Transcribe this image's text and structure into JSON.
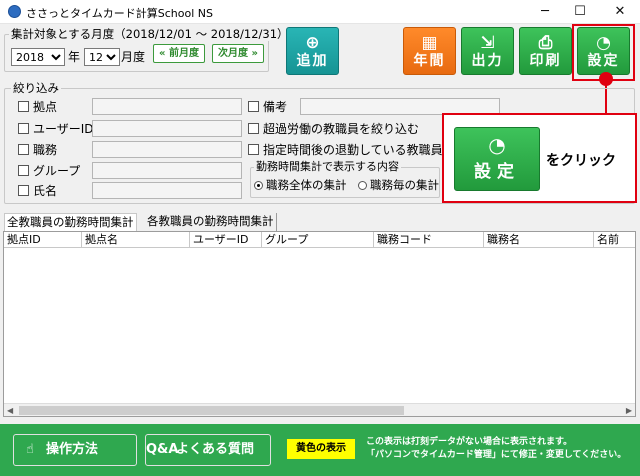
{
  "window": {
    "title": "ささっとタイムカード計算School NS",
    "minimize_label": "─",
    "maximize_label": "☐",
    "close_label": "✕"
  },
  "period": {
    "group_label": "集計対象とする月度（2018/12/01 〜 2018/12/31）",
    "year_value": "2018",
    "year_unit": "年",
    "month_value": "12",
    "month_unit": "月度",
    "prev_label": "« 前月度",
    "next_label": "次月度 »"
  },
  "toolbar": {
    "add_label": "追加",
    "annual_label": "年間",
    "output_label": "出力",
    "print_label": "印刷",
    "settings_label": "設定"
  },
  "filter": {
    "group_label": "絞り込み",
    "base_label": "拠点",
    "userid_label": "ユーザーID",
    "job_label": "職務",
    "group_field_label": "グループ",
    "name_label": "氏名",
    "remarks_label": "備考",
    "overtime_label": "超過労働の教職員を絞り込む",
    "early_leave_label": "指定時間後の退勤している教職員を",
    "display_group_label": "勤務時間集計で表示する内容",
    "radio_all_label": "職務全体の集計",
    "radio_each_label": "職務毎の集計"
  },
  "tabs": [
    {
      "label": "全教職員の勤務時間集計"
    },
    {
      "label": "各教職員の勤務時間集計"
    }
  ],
  "table": {
    "columns": [
      "拠点ID",
      "拠点名",
      "ユーザーID",
      "グループ",
      "職務コード",
      "職務名",
      "名前"
    ]
  },
  "footer": {
    "manual_label": "操作方法",
    "faq_label": "よくある質問",
    "yellow_label": "黄色の表示",
    "note_line1": "この表示は打刻データがない場合に表示されます。",
    "note_line2": "「パソコンでタイムカード管理」にて修正・変更してください。"
  },
  "callout": {
    "button_label": "設定",
    "text": "をクリック"
  },
  "colors": {
    "accent_green": "#2fa84f",
    "teal": "#169494",
    "orange": "#e86a10",
    "highlight_red": "#e00010"
  }
}
